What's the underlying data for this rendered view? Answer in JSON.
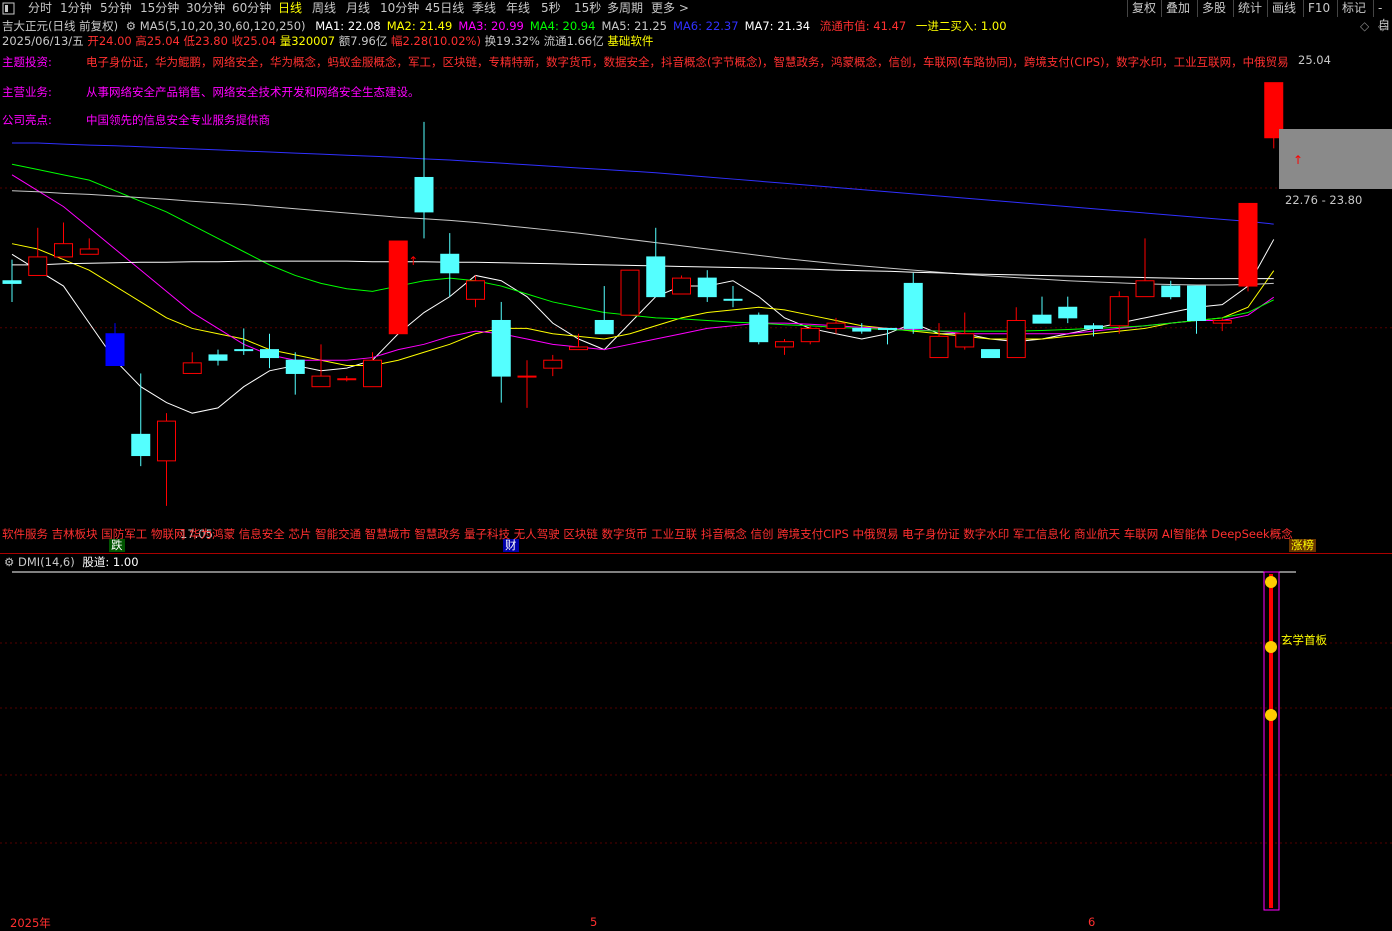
{
  "toolbar": {
    "periods": [
      "分时",
      "1分钟",
      "5分钟",
      "15分钟",
      "30分钟",
      "60分钟",
      "日线",
      "周线",
      "月线",
      "10分钟",
      "45日线",
      "季线",
      "年线",
      "5秒",
      "15秒",
      "多周期",
      "更多 >"
    ],
    "active_period": "日线",
    "right_buttons": [
      "复权",
      "叠加",
      "多股",
      "统计",
      "画线",
      "F10",
      "标记",
      "-自"
    ]
  },
  "header": {
    "title": "吉大正元(日线 前复权)",
    "ma_params": "MA5(5,10,20,30,60,120,250)",
    "ma": [
      {
        "label": "MA1: 22.08",
        "color": "#ffffff"
      },
      {
        "label": "MA2: 21.49",
        "color": "#ffff00"
      },
      {
        "label": "MA3: 20.99",
        "color": "#ff00ff"
      },
      {
        "label": "MA4: 20.94",
        "color": "#00ff00"
      },
      {
        "label": "MA5: 21.25",
        "color": "#c8c8c8"
      },
      {
        "label": "MA6: 22.37",
        "color": "#3030ff"
      },
      {
        "label": "MA7: 21.34",
        "color": "#ffffff"
      }
    ],
    "market_value": "流通市值: 41.47",
    "signal": "一进二买入: 1.00"
  },
  "quote": {
    "date": "2025/06/13/五",
    "open": "开24.00",
    "high": "高25.04",
    "low": "低23.80",
    "close": "收25.04",
    "volume": "量320007",
    "amount": "额7.96亿",
    "change": "幅2.28(10.02%)",
    "turnover": "换19.32%",
    "float": "流通1.66亿",
    "sector": "基础软件"
  },
  "info": {
    "theme_label": "主题投资:",
    "themes": "电子身份证，华为鲲鹏，网络安全，华为概念，蚂蚁金服概念，军工，区块链，专精特新，数字货币，数据安全，抖音概念(字节概念)，智慧政务，鸿蒙概念，信创，车联网(车路协同)，跨境支付(CIPS)，数字水印，工业互联网，中俄贸易",
    "business_label": "主营业务:",
    "business": "从事网络安全产品销售、网络安全技术开发和网络安全生态建设。",
    "highlight_label": "公司亮点:",
    "highlight": "中国领先的信息安全专业服务提供商"
  },
  "chart_annotations": {
    "high_label": "25.04",
    "low_label": "17.05",
    "range_label": "22.76 - 23.80"
  },
  "concepts_bar": "软件服务 吉林板块 国防军工 物联网 华为鸿蒙 信息安全 芯片 智能交通 智慧城市 智慧政务 量子科技 无人驾驶 区块链 数字货币 工业互联 抖音概念 信创 跨境支付CIPS 中俄贸易 电子身份证 数字水印 军工信息化 商业航天 车联网 AI智能体 DeepSeek概念",
  "event_tags": {
    "drop": "跌",
    "finance": "财",
    "limit_list": "涨榜"
  },
  "indicator": {
    "name": "DMI(14,6)",
    "value": "股道: 1.00",
    "tag": "玄学首板"
  },
  "time_axis": {
    "labels": [
      "2025年",
      "5",
      "6"
    ]
  },
  "chart_data": {
    "type": "candlestick",
    "title": "吉大正元(日线 前复权)",
    "ylim": [
      16.5,
      25.6
    ],
    "candles": [
      {
        "o": 21.3,
        "c": 21.25,
        "h": 21.7,
        "l": 20.9,
        "color": "cyan"
      },
      {
        "o": 21.4,
        "c": 21.75,
        "h": 22.3,
        "l": 21.4,
        "color": "red"
      },
      {
        "o": 21.75,
        "c": 22.0,
        "h": 22.4,
        "l": 21.75,
        "color": "red"
      },
      {
        "o": 21.9,
        "c": 21.8,
        "h": 22.1,
        "l": 21.8,
        "color": "red"
      },
      {
        "o": 20.3,
        "c": 19.7,
        "h": 20.5,
        "l": 19.7,
        "color": "blue"
      },
      {
        "o": 18.4,
        "c": 18.0,
        "h": 19.55,
        "l": 17.8,
        "color": "cyan"
      },
      {
        "o": 17.9,
        "c": 18.65,
        "h": 18.8,
        "l": 17.05,
        "color": "red"
      },
      {
        "o": 19.55,
        "c": 19.75,
        "h": 19.95,
        "l": 19.55,
        "color": "red"
      },
      {
        "o": 19.9,
        "c": 19.8,
        "h": 20.0,
        "l": 19.7,
        "color": "cyan"
      },
      {
        "o": 20.0,
        "c": 20.0,
        "h": 20.4,
        "l": 19.9,
        "color": "cyan"
      },
      {
        "o": 20.0,
        "c": 19.85,
        "h": 20.3,
        "l": 19.65,
        "color": "cyan"
      },
      {
        "o": 19.8,
        "c": 19.55,
        "h": 19.95,
        "l": 19.15,
        "color": "cyan"
      },
      {
        "o": 19.3,
        "c": 19.5,
        "h": 20.1,
        "l": 19.3,
        "color": "red"
      },
      {
        "o": 19.45,
        "c": 19.45,
        "h": 19.5,
        "l": 19.4,
        "color": "red"
      },
      {
        "o": 19.3,
        "c": 19.8,
        "h": 19.95,
        "l": 19.3,
        "color": "red"
      },
      {
        "o": 20.3,
        "c": 22.05,
        "h": 22.05,
        "l": 20.3,
        "color": "red"
      },
      {
        "o": 22.6,
        "c": 23.25,
        "h": 24.3,
        "l": 22.1,
        "color": "cyan"
      },
      {
        "o": 21.8,
        "c": 21.45,
        "h": 22.2,
        "l": 21.0,
        "color": "cyan"
      },
      {
        "o": 21.3,
        "c": 20.95,
        "h": 21.4,
        "l": 20.8,
        "color": "red"
      },
      {
        "o": 20.55,
        "c": 19.5,
        "h": 20.9,
        "l": 19.0,
        "color": "cyan"
      },
      {
        "o": 19.5,
        "c": 19.5,
        "h": 19.8,
        "l": 18.9,
        "color": "red"
      },
      {
        "o": 19.65,
        "c": 19.8,
        "h": 19.9,
        "l": 19.5,
        "color": "red"
      },
      {
        "o": 20.05,
        "c": 20.0,
        "h": 20.3,
        "l": 20.0,
        "color": "red"
      },
      {
        "o": 20.3,
        "c": 20.55,
        "h": 21.2,
        "l": 20.3,
        "color": "cyan"
      },
      {
        "o": 20.65,
        "c": 21.5,
        "h": 21.5,
        "l": 20.65,
        "color": "red"
      },
      {
        "o": 21.75,
        "c": 21.0,
        "h": 22.3,
        "l": 21.0,
        "color": "cyan"
      },
      {
        "o": 21.35,
        "c": 21.05,
        "h": 21.4,
        "l": 21.05,
        "color": "red"
      },
      {
        "o": 21.35,
        "c": 21.0,
        "h": 21.5,
        "l": 20.9,
        "color": "cyan"
      },
      {
        "o": 20.95,
        "c": 20.95,
        "h": 21.2,
        "l": 20.8,
        "color": "cyan"
      },
      {
        "o": 20.65,
        "c": 20.15,
        "h": 20.7,
        "l": 20.1,
        "color": "cyan"
      },
      {
        "o": 20.05,
        "c": 20.15,
        "h": 20.2,
        "l": 19.9,
        "color": "red"
      },
      {
        "o": 20.15,
        "c": 20.4,
        "h": 20.45,
        "l": 20.1,
        "color": "red"
      },
      {
        "o": 20.4,
        "c": 20.5,
        "h": 20.6,
        "l": 20.3,
        "color": "red"
      },
      {
        "o": 20.4,
        "c": 20.35,
        "h": 20.5,
        "l": 20.3,
        "color": "cyan"
      },
      {
        "o": 20.4,
        "c": 20.4,
        "h": 20.4,
        "l": 20.1,
        "color": "cyan"
      },
      {
        "o": 21.25,
        "c": 20.4,
        "h": 21.45,
        "l": 20.3,
        "color": "cyan"
      },
      {
        "o": 19.85,
        "c": 20.25,
        "h": 20.5,
        "l": 19.85,
        "color": "red"
      },
      {
        "o": 20.05,
        "c": 20.3,
        "h": 20.7,
        "l": 20.0,
        "color": "red"
      },
      {
        "o": 20.0,
        "c": 19.85,
        "h": 20.0,
        "l": 19.85,
        "color": "cyan"
      },
      {
        "o": 19.85,
        "c": 20.55,
        "h": 20.8,
        "l": 19.85,
        "color": "red"
      },
      {
        "o": 20.65,
        "c": 20.5,
        "h": 21.0,
        "l": 20.5,
        "color": "cyan"
      },
      {
        "o": 20.8,
        "c": 20.6,
        "h": 21.0,
        "l": 20.5,
        "color": "cyan"
      },
      {
        "o": 20.4,
        "c": 20.45,
        "h": 20.5,
        "l": 20.25,
        "color": "cyan"
      },
      {
        "o": 20.45,
        "c": 21.0,
        "h": 21.1,
        "l": 20.3,
        "color": "red"
      },
      {
        "o": 21.0,
        "c": 21.3,
        "h": 22.1,
        "l": 21.0,
        "color": "red"
      },
      {
        "o": 21.2,
        "c": 21.0,
        "h": 21.3,
        "l": 20.95,
        "color": "cyan"
      },
      {
        "o": 21.2,
        "c": 20.55,
        "h": 21.2,
        "l": 20.3,
        "color": "cyan"
      },
      {
        "o": 20.5,
        "c": 20.55,
        "h": 20.6,
        "l": 20.35,
        "color": "red"
      },
      {
        "o": 21.2,
        "c": 22.76,
        "h": 22.76,
        "l": 21.1,
        "color": "red"
      },
      {
        "o": 24.0,
        "c": 25.04,
        "h": 25.04,
        "l": 23.8,
        "color": "red"
      }
    ],
    "ma_series": [
      {
        "name": "MA1",
        "color": "#ffffff",
        "values": [
          21.8,
          21.5,
          21.2,
          20.5,
          19.8,
          19.3,
          19.0,
          18.8,
          18.9,
          19.3,
          19.6,
          19.7,
          19.6,
          19.65,
          19.8,
          20.3,
          20.7,
          21.0,
          21.4,
          21.3,
          21.0,
          20.5,
          20.2,
          20.0,
          20.5,
          21.0,
          21.2,
          21.2,
          21.3,
          21.0,
          20.6,
          20.4,
          20.3,
          20.2,
          20.3,
          20.5,
          20.3,
          20.3,
          20.2,
          20.15,
          20.2,
          20.3,
          20.4,
          20.5,
          20.6,
          20.7,
          20.8,
          20.85,
          21.2,
          22.08
        ]
      },
      {
        "name": "MA2",
        "color": "#ffff00",
        "values": [
          22.0,
          21.9,
          21.7,
          21.5,
          21.2,
          20.9,
          20.6,
          20.4,
          20.3,
          20.2,
          20.0,
          19.9,
          19.8,
          19.7,
          19.7,
          19.8,
          19.95,
          20.1,
          20.3,
          20.4,
          20.4,
          20.3,
          20.25,
          20.2,
          20.3,
          20.45,
          20.6,
          20.7,
          20.75,
          20.8,
          20.75,
          20.65,
          20.55,
          20.45,
          20.4,
          20.35,
          20.3,
          20.25,
          20.2,
          20.2,
          20.2,
          20.25,
          20.3,
          20.35,
          20.4,
          20.5,
          20.55,
          20.6,
          20.8,
          21.49
        ]
      },
      {
        "name": "MA3",
        "color": "#ff00ff",
        "values": [
          23.3,
          23.0,
          22.7,
          22.3,
          21.9,
          21.5,
          21.1,
          20.7,
          20.4,
          20.1,
          19.9,
          19.8,
          19.8,
          19.8,
          19.85,
          20.0,
          20.1,
          20.25,
          20.35,
          20.3,
          20.2,
          20.1,
          20.05,
          20.0,
          20.1,
          20.2,
          20.3,
          20.4,
          20.45,
          20.5,
          20.5,
          20.48,
          20.45,
          20.42,
          20.4,
          20.38,
          20.35,
          20.3,
          20.3,
          20.3,
          20.3,
          20.3,
          20.35,
          20.4,
          20.45,
          20.5,
          20.55,
          20.55,
          20.65,
          20.99
        ]
      },
      {
        "name": "MA4",
        "color": "#00ff00",
        "values": [
          23.5,
          23.4,
          23.3,
          23.2,
          23.0,
          22.8,
          22.6,
          22.35,
          22.1,
          21.85,
          21.6,
          21.4,
          21.25,
          21.15,
          21.1,
          21.2,
          21.3,
          21.35,
          21.3,
          21.2,
          21.05,
          20.9,
          20.8,
          20.7,
          20.65,
          20.6,
          20.58,
          20.55,
          20.52,
          20.5,
          20.47,
          20.45,
          20.42,
          20.4,
          20.38,
          20.36,
          20.35,
          20.35,
          20.35,
          20.35,
          20.36,
          20.38,
          20.4,
          20.42,
          20.45,
          20.5,
          20.55,
          20.6,
          20.7,
          20.94
        ]
      },
      {
        "name": "MA5",
        "color": "#c8c8c8",
        "values": [
          23.0,
          22.98,
          22.95,
          22.93,
          22.9,
          22.87,
          22.84,
          22.8,
          22.77,
          22.74,
          22.7,
          22.66,
          22.62,
          22.58,
          22.54,
          22.5,
          22.47,
          22.44,
          22.4,
          22.35,
          22.3,
          22.25,
          22.2,
          22.14,
          22.08,
          22.02,
          21.96,
          21.9,
          21.84,
          21.78,
          21.72,
          21.67,
          21.62,
          21.58,
          21.54,
          21.5,
          21.46,
          21.42,
          21.39,
          21.36,
          21.33,
          21.3,
          21.28,
          21.26,
          21.24,
          21.23,
          21.22,
          21.22,
          21.23,
          21.25
        ]
      },
      {
        "name": "MA6",
        "color": "#3030ff",
        "values": [
          23.9,
          23.9,
          23.88,
          23.86,
          23.85,
          23.83,
          23.81,
          23.79,
          23.77,
          23.75,
          23.73,
          23.71,
          23.69,
          23.67,
          23.65,
          23.63,
          23.6,
          23.58,
          23.55,
          23.52,
          23.49,
          23.46,
          23.43,
          23.4,
          23.37,
          23.34,
          23.3,
          23.26,
          23.22,
          23.18,
          23.14,
          23.1,
          23.06,
          23.02,
          22.98,
          22.94,
          22.9,
          22.86,
          22.82,
          22.78,
          22.74,
          22.7,
          22.66,
          22.62,
          22.58,
          22.54,
          22.5,
          22.46,
          22.42,
          22.37
        ]
      },
      {
        "name": "MA7",
        "color": "#ffffff",
        "values": [
          21.6,
          21.6,
          21.62,
          21.63,
          21.64,
          21.65,
          21.65,
          21.66,
          21.66,
          21.67,
          21.67,
          21.67,
          21.67,
          21.67,
          21.66,
          21.66,
          21.66,
          21.65,
          21.65,
          21.64,
          21.63,
          21.62,
          21.61,
          21.6,
          21.59,
          21.58,
          21.57,
          21.56,
          21.55,
          21.54,
          21.53,
          21.52,
          21.5,
          21.49,
          21.48,
          21.46,
          21.45,
          21.43,
          21.42,
          21.41,
          21.4,
          21.39,
          21.38,
          21.37,
          21.36,
          21.35,
          21.34,
          21.34,
          21.34,
          21.34
        ]
      }
    ]
  }
}
